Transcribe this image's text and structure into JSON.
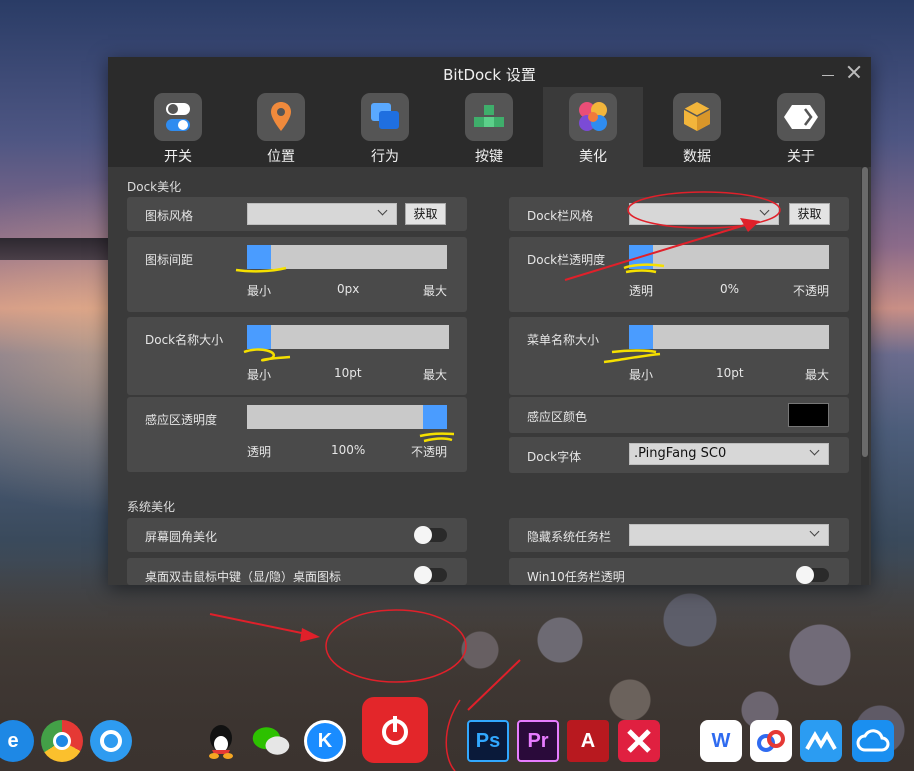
{
  "window": {
    "title": "BitDock 设置"
  },
  "tabs": [
    {
      "label": "开关",
      "icon": "toggle-switches-icon",
      "color": "#ffffff"
    },
    {
      "label": "位置",
      "icon": "location-pin-icon",
      "color": "#f08a3c"
    },
    {
      "label": "行为",
      "icon": "stacked-windows-icon",
      "color": "#2f8cf0"
    },
    {
      "label": "按键",
      "icon": "keys-icon",
      "color": "#3fae6b"
    },
    {
      "label": "美化",
      "icon": "palette-icon",
      "color": "#e94e77"
    },
    {
      "label": "数据",
      "icon": "cube-icon",
      "color": "#f2b53b"
    },
    {
      "label": "关于",
      "icon": "hexagon-arrows-icon",
      "color": "#ffffff"
    }
  ],
  "active_tab": "美化",
  "dock_section": {
    "title": "Dock美化",
    "icon_style": {
      "label": "图标风格",
      "value": "",
      "button": "获取"
    },
    "dockbar_style": {
      "label": "Dock栏风格",
      "value": "",
      "button": "获取"
    },
    "icon_spacing": {
      "label": "图标间距",
      "min": "最小",
      "value": "0px",
      "max": "最大",
      "level": 0
    },
    "dockbar_opacity": {
      "label": "Dock栏透明度",
      "min": "透明",
      "value": "0%",
      "max": "不透明",
      "level": 0
    },
    "dock_name_size": {
      "label": "Dock名称大小",
      "min": "最小",
      "value": "10pt",
      "max": "最大",
      "level": 0
    },
    "menu_name_size": {
      "label": "菜单名称大小",
      "min": "最小",
      "value": "10pt",
      "max": "最大",
      "level": 0
    },
    "sensor_opacity": {
      "label": "感应区透明度",
      "min": "透明",
      "value": "100%",
      "max": "不透明",
      "level": 1
    },
    "sensor_color": {
      "label": "感应区颜色",
      "color": "#000000"
    },
    "dock_font": {
      "label": "Dock字体",
      "value": ".PingFang SC0"
    }
  },
  "system_section": {
    "title": "系统美化",
    "rounded_corners": {
      "label": "屏幕圆角美化",
      "on": false
    },
    "hide_taskbar": {
      "label": "隐藏系统任务栏",
      "value": ""
    },
    "double_click": {
      "label": "桌面双击鼠标中键（显/隐）桌面图标",
      "on": false
    },
    "win10_transparent": {
      "label": "Win10任务栏透明",
      "on": false
    }
  },
  "dock_apps": [
    {
      "name": "ie-icon",
      "text": "e",
      "color": "#1e88e5"
    },
    {
      "name": "chrome-icon",
      "text": "",
      "color": "#e53935"
    },
    {
      "name": "qq-browser-icon",
      "text": "",
      "color": "#2e9bf0"
    },
    {
      "name": "qq-icon",
      "text": "",
      "color": "#111111"
    },
    {
      "name": "wechat-icon",
      "text": "",
      "color": "#2dc100"
    },
    {
      "name": "kugou-icon",
      "text": "K",
      "color": "#1a8cff"
    },
    {
      "name": "netease-music-icon",
      "text": "",
      "color": "#e3262a"
    },
    {
      "name": "photoshop-icon",
      "text": "Ps",
      "color": "#0a1a3a"
    },
    {
      "name": "premiere-icon",
      "text": "Pr",
      "color": "#2a0a3a"
    },
    {
      "name": "autocad-icon",
      "text": "A",
      "color": "#b8191f"
    },
    {
      "name": "xmind-icon",
      "text": "",
      "color": "#e02040"
    },
    {
      "name": "wps-icon",
      "text": "W",
      "color": "#2f6bf0"
    },
    {
      "name": "baidu-netdisk-icon",
      "text": "",
      "color": "#ffffff"
    },
    {
      "name": "teambition-icon",
      "text": "",
      "color": "#2b9cf2"
    },
    {
      "name": "cloud-sync-icon",
      "text": "",
      "color": "#1a8ff0"
    }
  ]
}
